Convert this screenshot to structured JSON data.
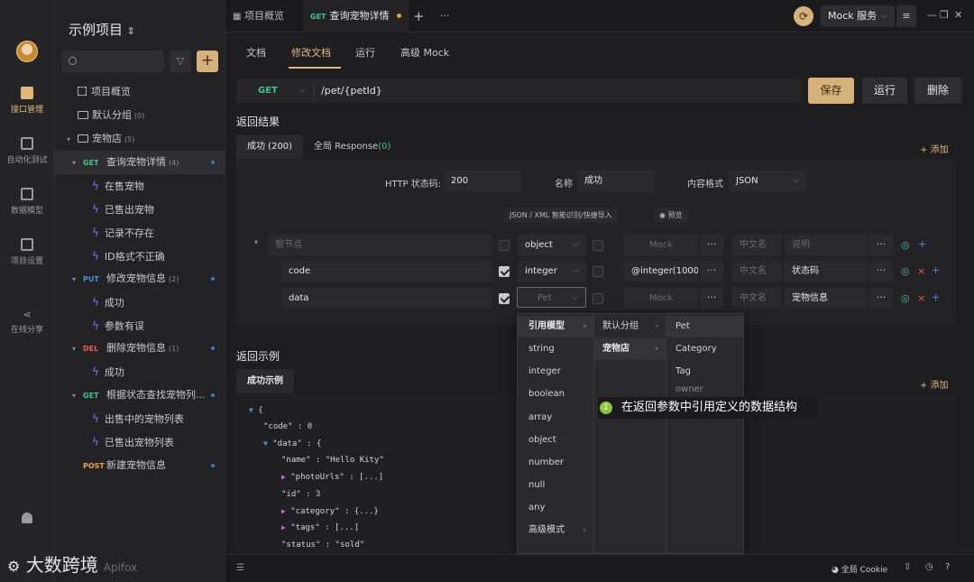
{
  "rail": {
    "items": [
      {
        "label": "接口管理",
        "icon": "api-icon"
      },
      {
        "label": "自动化测试",
        "icon": "test-icon"
      },
      {
        "label": "数据模型",
        "icon": "model-icon"
      },
      {
        "label": "项目设置",
        "icon": "settings-icon"
      },
      {
        "label": "在线分享",
        "icon": "share-icon"
      }
    ]
  },
  "sidebar": {
    "project_title": "示例项目",
    "project_chevron": "⌃",
    "tree": [
      {
        "label": "项目概览"
      },
      {
        "label": "默认分组",
        "count": "(0)"
      },
      {
        "label": "宠物店",
        "count": "(5)"
      },
      {
        "method": "GET",
        "label": "查询宠物详情",
        "count": "(4)"
      },
      {
        "label": "在售宠物"
      },
      {
        "label": "已售出宠物"
      },
      {
        "label": "记录不存在"
      },
      {
        "label": "ID格式不正确"
      },
      {
        "method": "PUT",
        "label": "修改宠物信息",
        "count": "(2)"
      },
      {
        "label": "成功"
      },
      {
        "label": "参数有误"
      },
      {
        "method": "DEL",
        "label": "删除宠物信息",
        "count": "(1)"
      },
      {
        "label": "成功"
      },
      {
        "method": "GET",
        "label": "根据状态查找宠物列..."
      },
      {
        "label": "出售中的宠物列表"
      },
      {
        "label": "已售出宠物列表"
      },
      {
        "method": "POST",
        "label": "新建宠物信息"
      }
    ]
  },
  "topbar": {
    "tabs": [
      {
        "label": "项目概览"
      },
      {
        "method": "GET",
        "label": "查询宠物详情"
      }
    ],
    "new_tab": "+",
    "more_tabs": "···",
    "mock_service": "Mock 服务"
  },
  "main": {
    "subtabs": [
      "文档",
      "修改文档",
      "运行",
      "高级 Mock"
    ],
    "url": {
      "method": "GET",
      "path": "/pet/{petId}"
    },
    "buttons": {
      "save": "保存",
      "run": "运行",
      "delete": "删除"
    },
    "response_title": "返回结果",
    "response_tabs": {
      "success": "成功 (200)",
      "global": "全局 Response",
      "global_count": "(0)"
    },
    "add_label": "+ 添加",
    "http_status_label": "HTTP 状态码:",
    "http_status_value": "200",
    "name_label": "名称",
    "name_value": "成功",
    "format_label": "内容格式",
    "format_value": "JSON",
    "import_chip": "JSON / XML 智能识别/快捷导入",
    "preview_chip": "◉ 预览",
    "schema_rows": [
      {
        "name": "根节点",
        "type": "object",
        "mock": "Mock",
        "cn": "中文名",
        "desc": "说明"
      },
      {
        "name": "code",
        "type": "integer",
        "mock": "@integer(1000",
        "cn": "中文名",
        "desc": "状态码"
      },
      {
        "name": "data",
        "type": "Pet",
        "mock": "Mock",
        "cn": "中文名",
        "desc": "宠物信息"
      }
    ],
    "example_title": "返回示例",
    "example_tab": "成功示例"
  },
  "code_lines": [
    "{",
    "\"code\" : 0",
    "\"data\" : {",
    "\"name\" : \"Hello Kity\"",
    "\"photoUrls\" : [...]",
    "\"id\" : 3",
    "\"category\" : {...}",
    "\"tags\" : [...]",
    "\"status\" : \"sold\""
  ],
  "dropdown": {
    "col1": [
      {
        "label": "引用模型"
      },
      {
        "label": "string"
      },
      {
        "label": "integer"
      },
      {
        "label": "boolean"
      },
      {
        "label": "array"
      },
      {
        "label": "object"
      },
      {
        "label": "number"
      },
      {
        "label": "null"
      },
      {
        "label": "any"
      },
      {
        "label": "高级模式"
      }
    ],
    "col2": [
      {
        "label": "默认分组"
      },
      {
        "label": "宠物店"
      }
    ],
    "col3": [
      {
        "label": "Pet"
      },
      {
        "label": "Category"
      },
      {
        "label": "Tag"
      },
      {
        "label": "owner"
      }
    ]
  },
  "tooltip": {
    "num": "1",
    "text": "在返回参数中引用定义的数据结构"
  },
  "bottombar": {
    "cookie": "全局 Cookie"
  },
  "watermark": {
    "brand": "大数跨境",
    "app": "Apifox"
  }
}
